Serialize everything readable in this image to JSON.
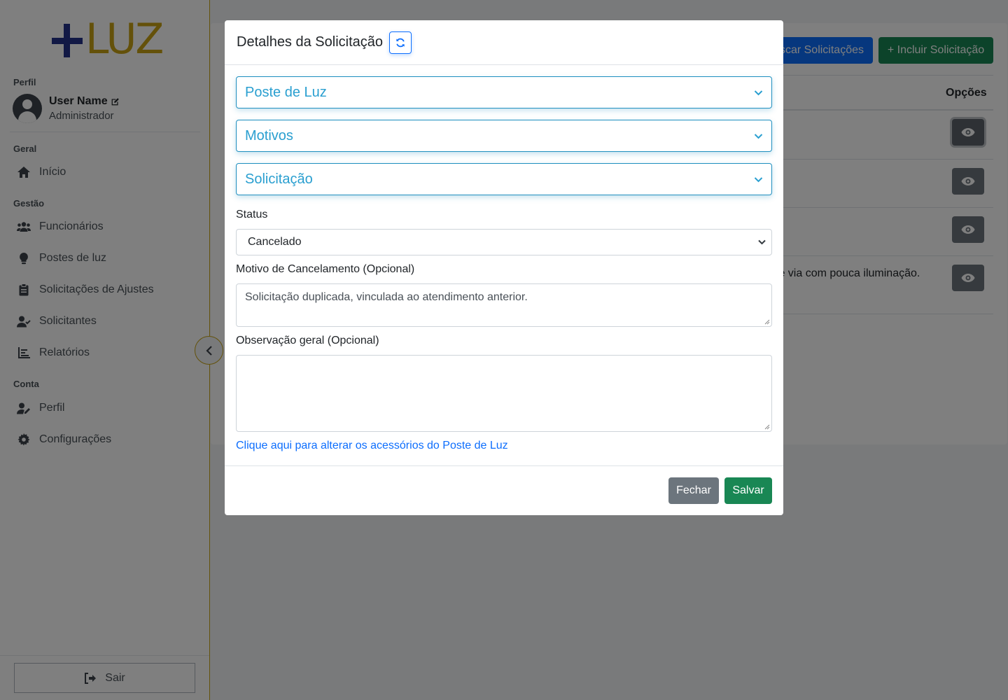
{
  "sidebar": {
    "logo": {
      "plus": "+",
      "word": "LUZ"
    },
    "profile_section": "Perfil",
    "user_name": "User Name",
    "user_role": "Administrador",
    "section_geral": "Geral",
    "section_gestao": "Gestão",
    "section_conta": "Conta",
    "items": [
      {
        "label": "Início",
        "icon": "home-icon"
      },
      {
        "label": "Funcionários",
        "icon": "users-icon"
      },
      {
        "label": "Postes de luz",
        "icon": "lightbulb-icon"
      },
      {
        "label": "Solicitações de Ajustes",
        "icon": "clipboard-icon"
      },
      {
        "label": "Solicitantes",
        "icon": "user-check-icon"
      },
      {
        "label": "Relatórios",
        "icon": "chart-icon"
      },
      {
        "label": "Perfil",
        "icon": "user-edit-icon"
      },
      {
        "label": "Configurações",
        "icon": "gear-icon"
      }
    ],
    "logout_label": "Sair"
  },
  "main": {
    "search_button": "Buscar Solicitações",
    "add_button": "+ Incluir Solicitação",
    "options_header": "Opções",
    "row_text": "s e via com pouca iluminação."
  },
  "modal": {
    "title": "Detalhes da Solicitação",
    "accordions": [
      "Poste de Luz",
      "Motivos",
      "Solicitação"
    ],
    "status_label": "Status",
    "status_value": "Cancelado",
    "cancel_reason_label": "Motivo de Cancelamento (Opcional)",
    "cancel_reason_value": "Solicitação duplicada, vinculada ao atendimento anterior.",
    "observation_label": "Observação geral (Opcional)",
    "observation_value": "",
    "accessories_link": "Clique aqui para alterar os acessórios do Poste de Luz",
    "close_button": "Fechar",
    "save_button": "Salvar"
  },
  "colors": {
    "brand_blue": "#24338a",
    "brand_gold": "#c9a215",
    "accordion_blue": "#2a9fd0",
    "primary": "#0d6efd",
    "success": "#198754",
    "secondary": "#6c757d"
  }
}
